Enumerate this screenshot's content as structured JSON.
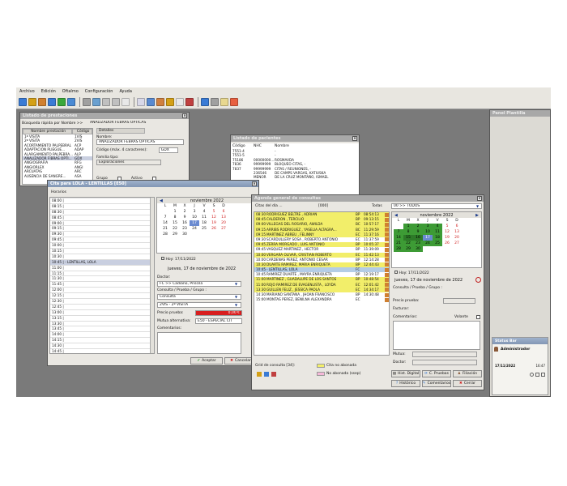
{
  "menubar": [
    "Archivo",
    "Edición",
    "Oftalmo",
    "Configuración",
    "Ayuda"
  ],
  "toolbar_colors": [
    "#3a7bd5",
    "#d4a017",
    "#d08030",
    "#3a7bd5",
    "#3aa83a",
    "#4a8ad4",
    "#a0a0a0",
    "#6aa0d0",
    "#c0c0c0",
    "#c0c0c0",
    "#e8e8e8",
    "#d8d8e8",
    "#5a8ad0",
    "#d08040",
    "#d4a017",
    "#e8e8e8",
    "#c04040",
    "#3a7bd5",
    "#a0a0a0",
    "#e8d890",
    "#e86040"
  ],
  "prest_window": {
    "title": "Listado de prestaciones",
    "search_label": "Búsqueda rápida por Nombre >>",
    "search_value": "ANALIZADOR FEBRAS ÓPTICAS",
    "col_name": "Nombre prestación",
    "col_code": "Código",
    "rows": [
      [
        "1ª VISITA",
        "1VIS"
      ],
      [
        "2ª VISITA",
        "2VIS"
      ],
      [
        "ACORTAMIENTO PALPEBRAL",
        "ACP"
      ],
      [
        "ADAPTACION PLIEGUE...",
        "ADAP"
      ],
      [
        "ALARGAMIENTO PALPEBRA...",
        "ALP"
      ],
      [
        "ANALIZADOR FIBRAS OPTI...",
        "GDX"
      ],
      [
        "ANGIOGRAFIA",
        "RFG"
      ],
      [
        "ANGIORLEX",
        "ANGI"
      ],
      [
        "ARCUATAS",
        "ARC"
      ],
      [
        "AUSENCIA DE SANGRE...",
        "ASA"
      ]
    ],
    "selected_row": 5,
    "details_title": "Detalles",
    "name_label": "Nombre:",
    "name_value": "ANALIZADOR FEBRAS ÓPTICAS",
    "code_label": "Código (máx. 4 caracteres):",
    "code_value": "GDX",
    "type_label": "Familia tipo:",
    "type_value": "Exploraciones",
    "group_label": "Grupo",
    "active_label": "Activo"
  },
  "pac_window": {
    "title": "Listado de pacientes",
    "col_code": "Código",
    "col_nhc": "NHC",
    "col_name": "Nombre",
    "rows": [
      [
        "7551-4",
        "",
        "-"
      ],
      [
        "7551-5",
        "",
        "-"
      ],
      [
        "75186",
        "00000000...",
        "ROSMAVDA"
      ],
      [
        "7836",
        "99999999",
        "BLOQUEO CITAS, -"
      ],
      [
        "7837",
        "99999999",
        "CITAS / REUNIONES, -"
      ],
      [
        "",
        "236546",
        "DE CAMPS VARGAS, KATIUSKA"
      ],
      [
        "",
        "MENOR",
        "DE LA CRUZ MONTAÑO, ISMAEL"
      ]
    ]
  },
  "cita_window": {
    "title": "Cita para LOLA - LENTILLAS [E50]",
    "hours_label": "Horarios",
    "hours": [
      "08:00 |",
      "08:15 |",
      "08:30 |",
      "08:45 |",
      "09:00 |",
      "09:15 |",
      "09:30 |",
      "09:45 |",
      "10:00 |",
      "10:15 |",
      "10:30 |",
      "10:45 | - LENTILLAS, LOLA",
      "11:00 |",
      "11:15 |",
      "11:30 |",
      "11:45 |",
      "12:00 |",
      "12:15 |",
      "12:30 |",
      "12:45 |",
      "13:00 |",
      "13:15 |",
      "13:30 |",
      "13:45 |",
      "14:00 |",
      "14:15 |",
      "14:30 |",
      "14:45 |"
    ],
    "selected_hour": 11,
    "cal_month": "noviembre 2022",
    "cal_days_header": [
      "L",
      "M",
      "X",
      "J",
      "V",
      "S",
      "D"
    ],
    "cal_weeks": [
      [
        "",
        "1",
        "2",
        "3",
        "4",
        "5",
        "6"
      ],
      [
        "7",
        "8",
        "9",
        "10",
        "11",
        "12",
        "13"
      ],
      [
        "14",
        "15",
        "16",
        "17",
        "18",
        "19",
        "20"
      ],
      [
        "21",
        "22",
        "23",
        "24",
        "25",
        "26",
        "27"
      ],
      [
        "28",
        "29",
        "30",
        "",
        "",
        "",
        ""
      ]
    ],
    "today_label": "Hoy: 17/11/2022",
    "date_label": "jueves, 17 de noviembre de 2022",
    "doctor_label": "Doctor:",
    "doctor_value": "FC >> Cadiano, Priscila",
    "consulta_label": "Consulta / Prueba / Grupo :",
    "consulta_value": "Consulta",
    "visita_value": "2VIS - 2ª VISITA",
    "precio_label": "Precio prueba:",
    "precio_value": "0,00 €",
    "mutua_label": "Mutua alternativa:",
    "mutua_value": "E50 - ESPECIAL CIT",
    "comments_label": "Comentarios:",
    "accept_label": "Aceptar",
    "cancel_label": "Cancelar"
  },
  "agenda_window": {
    "title": "Agenda general de consultas",
    "citas_label": "Citas del día ...",
    "count": "[000]",
    "todas_label": "Todas",
    "todas_value": "00 >> TODOS",
    "rows": [
      [
        "08:30",
        "RODRIGUEZ BELTRE , ADRIAN",
        "BP",
        "08:54:13",
        "#f2ee6a"
      ],
      [
        "08:45",
        "CALDERON , TERCILIO",
        "BP",
        "09:13:15",
        "#f2ee6a"
      ],
      [
        "09:00",
        "VILLEGAS DEL ROSARIO, AWILDA",
        "BC",
        "10:57:17",
        "#f2ee6a"
      ],
      [
        "09:15",
        "ARRIBS RODRIGUEZ , YASELIA ALTAGRA...",
        "BC",
        "11:29:59",
        "#f2ee6a"
      ],
      [
        "09:15",
        "MARTINEZ ABREU , FELINNY",
        "EC",
        "11:37:16",
        "#f2ee6a"
      ],
      [
        "09:30",
        "SCARDULLERY SOSA , ROBERTO ANTONIO",
        "EC",
        "11:37:59",
        "#ffffff"
      ],
      [
        "09:45",
        "ZERRA MORGADO , LUIS ANTONIO",
        "BP",
        "10:05:37",
        "#f2ee6a"
      ],
      [
        "09:45",
        "VASQUEZ MARTINEZ , HECTOR",
        "BP",
        "11:39:09",
        "#ffffff"
      ],
      [
        "10:00",
        "VERGARA OLIVAR, CRISTIAN ROBERTO",
        "EC",
        "11:42:13",
        "#f2ee6a"
      ],
      [
        "10:00",
        "CARDENAS PEREZ, ANTONIO CESAR",
        "BP",
        "12:14:28",
        "#ffffff"
      ],
      [
        "10:30",
        "DUARTE RAMIREZ, MARIA ENRIQUETA",
        "BP",
        "12:44:43",
        "#f2ee6a"
      ],
      [
        "10:45",
        "- LENTILLAS, LOLA",
        "FC",
        "",
        "#b4cde6"
      ],
      [
        "10:45",
        "RAMIREZ DUARTE , MAYRA ENRIQUETA",
        "BP",
        "12:19:17",
        "#ffffff"
      ],
      [
        "11:00",
        "MARTINEZ , GUADALUPE DE LOS SANTOS",
        "BP",
        "10:48:54",
        "#f2ee6a"
      ],
      [
        "11:00",
        "ROJO RAMIREZ DE EVAGENLISTA , LOYDA",
        "EC",
        "12:01:42",
        "#f2ee6a"
      ],
      [
        "13:30",
        "GUILLEN FELIZ , JESSICA PAOLA",
        "EC",
        "14:34:17",
        "#f2ee6a"
      ],
      [
        "14:30",
        "MARIANO SANTANA , JHOAN FRANCISCO",
        "BP",
        "14:30:48",
        "#ffffff"
      ],
      [
        "15:00",
        "MONTAS PEREZ, BENILNA ALEXANDRA",
        "EC",
        "",
        "#ffffff"
      ]
    ],
    "selected_row": 11,
    "cal_month": "noviembre 2022",
    "cal_days_header": [
      "L",
      "M",
      "X",
      "J",
      "V",
      "S",
      "D"
    ],
    "cal_weeks": [
      [
        "",
        "1",
        "2",
        "3",
        "4",
        "5",
        "6"
      ],
      [
        "7",
        "8",
        "9",
        "10",
        "11",
        "12",
        "13"
      ],
      [
        "14",
        "15",
        "16",
        "17",
        "18",
        "19",
        "20"
      ],
      [
        "21",
        "22",
        "23",
        "24",
        "25",
        "26",
        "27"
      ],
      [
        "28",
        "29",
        "30",
        "",
        "",
        "",
        ""
      ]
    ],
    "today_label": "Hoy: 17/11/2022",
    "date_label": "jueves, 17 de noviembre de 2022",
    "consulta_label": "Consulta / Prueba / Grupo :",
    "precio_label": "Precio prueba:",
    "factura_label": "Facturar:",
    "voluntad_label": "Volante",
    "comments_label": "Comentarios:",
    "mutua_label": "Mutua:",
    "doctor_label": "Doctor:",
    "legend_label": "Grid de consulta [34]:",
    "legend_items": [
      "Cita no abonada",
      "No abonada (ssep)"
    ],
    "buttons": [
      "Hist. Digital",
      "C. Pruebas",
      "Filiación",
      "Histórico",
      "Comentarios",
      "Cerrar"
    ]
  },
  "side_panel": {
    "title": "Panel Plantilla",
    "status_title": "Status Bar",
    "user": "Administrador",
    "date": "17/11/2022",
    "time": "16:47"
  }
}
